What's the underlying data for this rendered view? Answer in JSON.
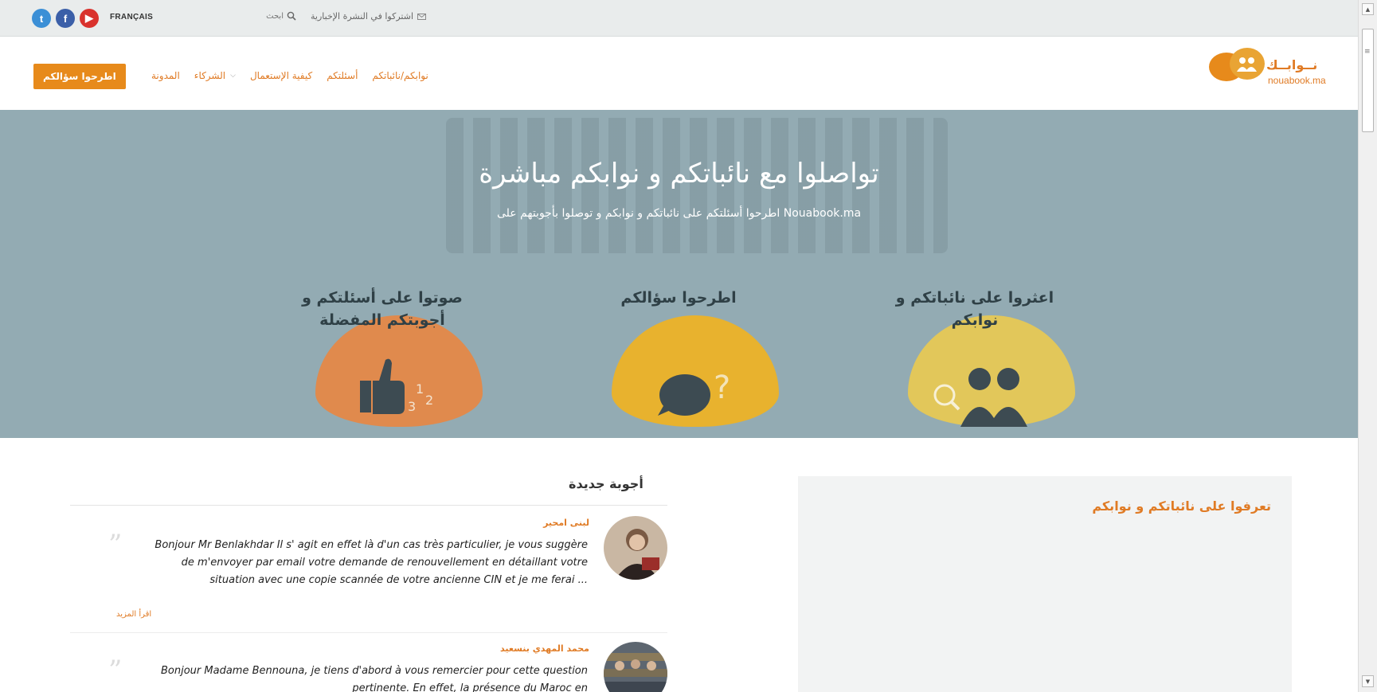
{
  "topbar": {
    "social": [
      {
        "name": "twitter-icon",
        "glyph": "t"
      },
      {
        "name": "facebook-icon",
        "glyph": "f"
      },
      {
        "name": "youtube-icon",
        "glyph": "▶"
      }
    ],
    "language_link": "FRANÇAIS",
    "search_placeholder": "ابحث",
    "newsletter_link": "اشتركوا في النشرة الإخبارية"
  },
  "nav": {
    "cta": "اطرحوا سؤالكم",
    "links": {
      "blog": "المدونة",
      "partners": "الشركاء",
      "how_to": "كيفية الإستعمال",
      "questions": "أسئلتكم",
      "deputies": "نوابكم/نائباتكم"
    },
    "logo": {
      "arabic": "نــوابــك",
      "latin": "nouabook.ma"
    }
  },
  "hero": {
    "title": "تواصلوا مع نائباتكم و نوابكم مباشرة",
    "subtitle": "اطرحوا أسئلتكم على نائباتكم و نوابكم و توصلوا بأجوبتهم على Nouabook.ma",
    "features": [
      {
        "label": "صوتوا على أسئلتكم و أجوبتكم المفضلة",
        "icon": "thumbs-up-ranking-icon"
      },
      {
        "label": "اطرحوا سؤالكم",
        "icon": "chat-question-icon"
      },
      {
        "label": "اعثروا على نائباتكم و نوابكم",
        "icon": "people-search-icon"
      }
    ]
  },
  "answers": {
    "title": "أجوبة جديدة",
    "items": [
      {
        "author": "لبنى امحير",
        "text": "Bonjour Mr Benlakhdar Il s' agit en effet là d'un cas très particulier, je vous suggère de m'envoyer par email votre demande de renouvellement en détaillant votre situation avec une copie scannée de votre ancienne CIN et je me ferai ...",
        "read_more": "اقرأ المزيد"
      },
      {
        "author": "محمد المهدي بنسعيد",
        "text": "Bonjour Madame Bennouna, je tiens d'abord à vous remercier pour cette question pertinente. En effet, la présence du Maroc en"
      }
    ]
  },
  "sidebar": {
    "title": "تعرفوا على نائباتكم و نوابكم"
  },
  "colors": {
    "accent": "#e78a1b",
    "link": "#e07b25",
    "hero_bg": "#93abb3",
    "blob_vote": "#e08a4d",
    "blob_ask": "#e8b22e",
    "blob_find": "#e2c75a"
  }
}
